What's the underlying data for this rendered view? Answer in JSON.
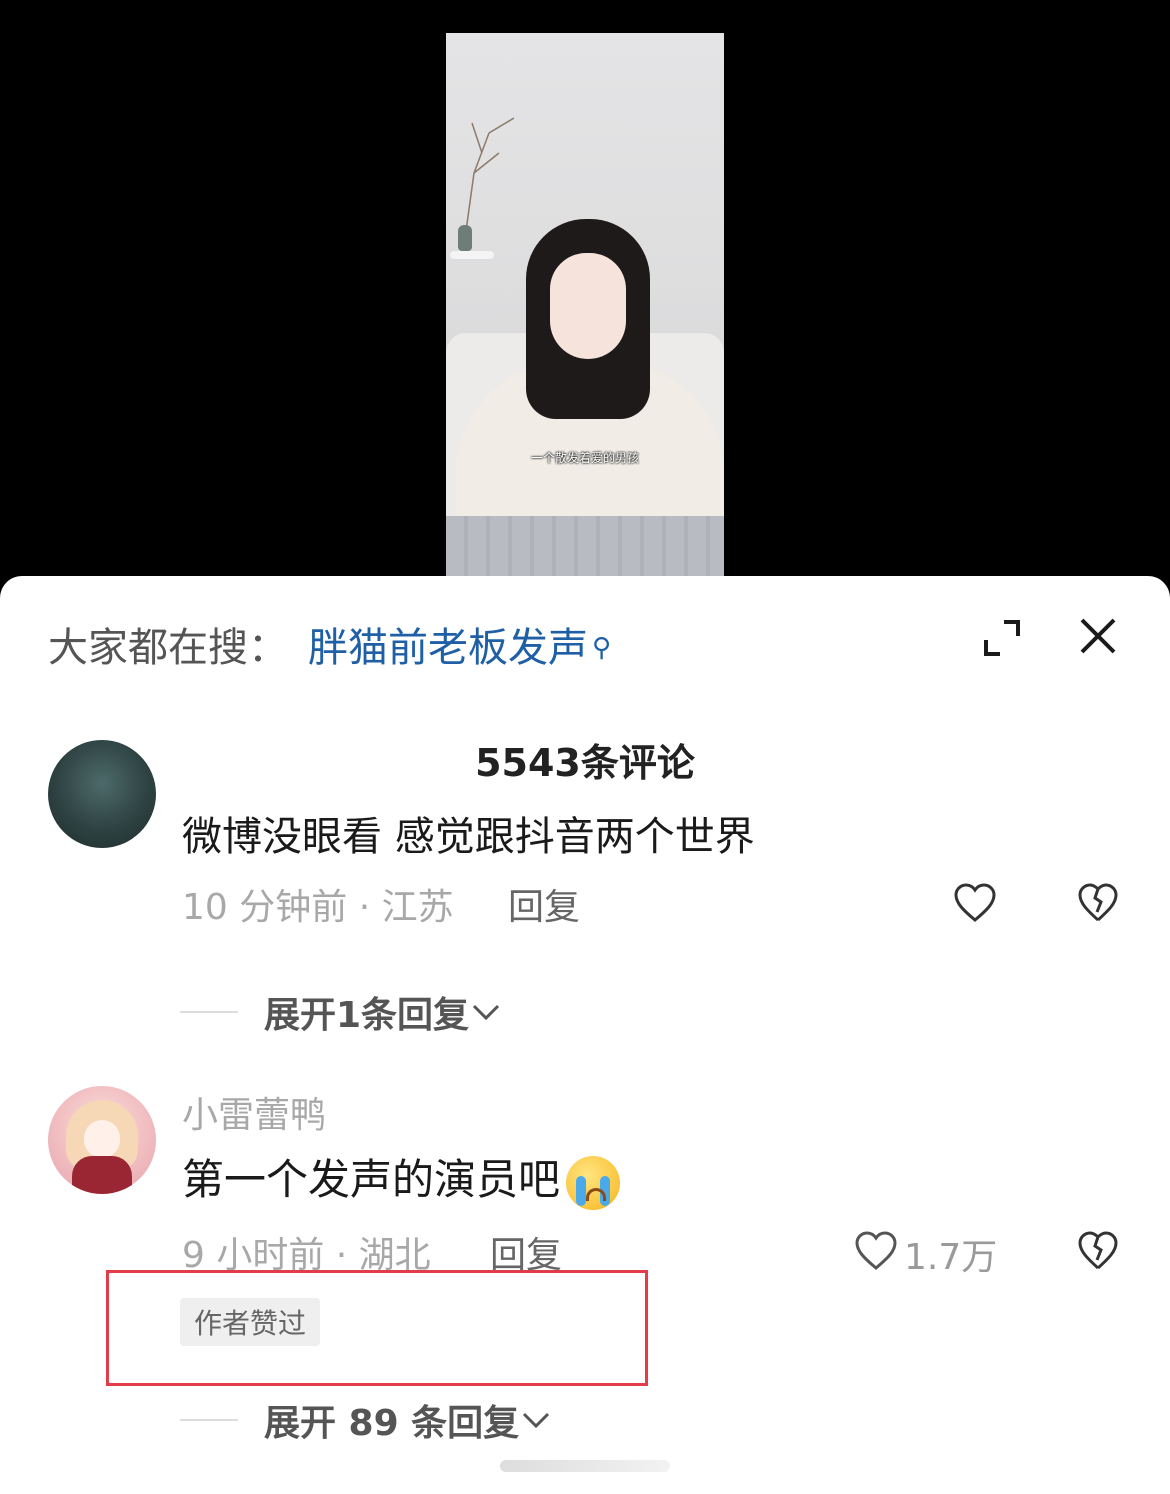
{
  "video": {
    "subtitle": "一个散发着爱的男孩"
  },
  "header": {
    "search_prefix": "大家都在搜：",
    "search_term": "胖猫前老板发声",
    "search_glyph": "Q",
    "expand_icon": "expand-icon",
    "close_icon": "close-icon",
    "link_color": "#1f5fa6"
  },
  "comments_title": "5543条评论",
  "comments": [
    {
      "text": "微博没眼看 感觉跟抖音两个世界",
      "meta": "10 分钟前 · 江苏",
      "reply_label": "回复",
      "expand_label": "展开1条回复"
    },
    {
      "username": "小雷蕾鸭",
      "text": "第一个发声的演员吧",
      "emoji": "loudly-crying-face",
      "meta": "9 小时前 · 湖北",
      "reply_label": "回复",
      "like_count": "1.7万",
      "badge": "作者赞过",
      "expand_label": "展开 89 条回复"
    }
  ],
  "highlight_color": "#e23b4a"
}
